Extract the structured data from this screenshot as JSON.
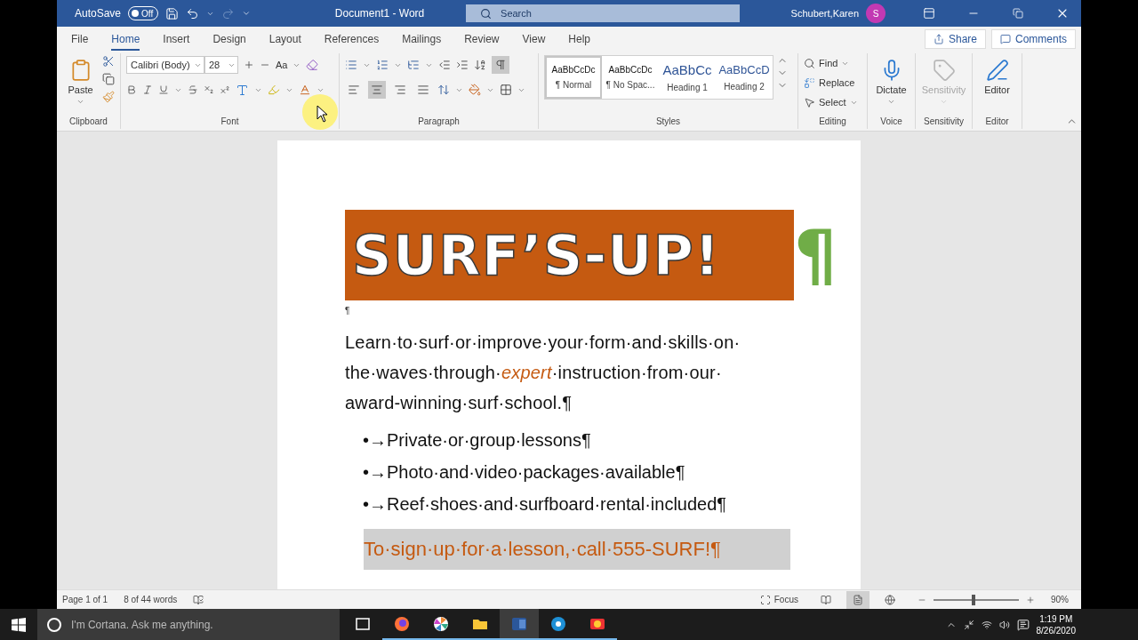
{
  "titlebar": {
    "autosave_label": "AutoSave",
    "autosave_toggle": {
      "label": "Off",
      "on": false
    },
    "title": "Document1  -  Word",
    "search": {
      "placeholder": "Search"
    },
    "user": "Schubert,Karen",
    "avatar": "S"
  },
  "tabs": [
    {
      "label": "File",
      "selected": false
    },
    {
      "label": "Home",
      "selected": true
    },
    {
      "label": "Insert",
      "selected": false
    },
    {
      "label": "Design",
      "selected": false
    },
    {
      "label": "Layout",
      "selected": false
    },
    {
      "label": "References",
      "selected": false
    },
    {
      "label": "Mailings",
      "selected": false
    },
    {
      "label": "Review",
      "selected": false
    },
    {
      "label": "View",
      "selected": false
    },
    {
      "label": "Help",
      "selected": false
    }
  ],
  "share": "Share",
  "comments": "Comments",
  "ribbon": {
    "clipboard": {
      "paste": "Paste",
      "label": "Clipboard"
    },
    "font": {
      "name": "Calibri (Body)",
      "size": "28",
      "case_button": "Aa",
      "label": "Font"
    },
    "paragraph": {
      "label": "Paragraph",
      "show_marks": true,
      "alignments": [
        {
          "kind": "left",
          "selected": false
        },
        {
          "kind": "center",
          "selected": true
        },
        {
          "kind": "right",
          "selected": false
        },
        {
          "kind": "justify",
          "selected": false
        }
      ]
    },
    "styles": {
      "label": "Styles",
      "items": [
        {
          "kind": "normal",
          "preview": "AaBbCcDc",
          "name": "¶ Normal",
          "selected": true
        },
        {
          "kind": "nospacing",
          "preview": "AaBbCcDc",
          "name": "¶ No Spac...",
          "selected": false
        },
        {
          "kind": "heading1",
          "preview": "AaBbCc",
          "name": "Heading 1",
          "selected": false
        },
        {
          "kind": "heading2",
          "preview": "AaBbCcD",
          "name": "Heading 2",
          "selected": false
        }
      ]
    },
    "editing": {
      "label": "Editing",
      "find": "Find",
      "replace": "Replace",
      "select": "Select"
    },
    "voice": {
      "button": "Dictate",
      "label": "Voice"
    },
    "sensitivity": {
      "button": "Sensitivity",
      "disabled": true,
      "label": "Sensitivity"
    },
    "editor": {
      "button": "Editor",
      "label": "Editor"
    }
  },
  "document": {
    "banner": {
      "title": "SURF’S-UP!",
      "mark": "¶"
    },
    "empty_mark": "¶",
    "paragraph_lines": [
      "Learn·to·surf·or·improve·your·form·and·skills·on·",
      "the·waves·through·*expert*·instruction·from·our·",
      "award-winning·surf·school.¶"
    ],
    "bullets": [
      "•→Private·or·group·lessons¶",
      "•→Photo·and·video·packages·available¶",
      "•→Reef·shoes·and·surfboard·rental·included¶"
    ],
    "callout": "To·sign·up·for·a·lesson,·call·555-SURF!¶"
  },
  "status_bar": {
    "page": "Page 1 of 1",
    "words": "8 of 44 words",
    "focus": "Focus",
    "views": [
      {
        "kind": "read",
        "selected": false
      },
      {
        "kind": "print",
        "selected": true
      },
      {
        "kind": "web",
        "selected": false
      }
    ],
    "zoom_slider": {
      "level": 0.47
    },
    "zoom": "90%"
  },
  "taskbar": {
    "search_placeholder": "I'm Cortana. Ask me anything.",
    "apps": [
      {
        "kind": "taskview",
        "selected": false
      },
      {
        "kind": "browser",
        "selected": false
      },
      {
        "kind": "pinwheel",
        "selected": false
      },
      {
        "kind": "folder",
        "selected": false
      },
      {
        "kind": "word",
        "selected": true
      },
      {
        "kind": "network",
        "selected": false
      },
      {
        "kind": "media",
        "selected": false
      }
    ],
    "time": "1:19 PM",
    "date": "8/26/2020"
  }
}
